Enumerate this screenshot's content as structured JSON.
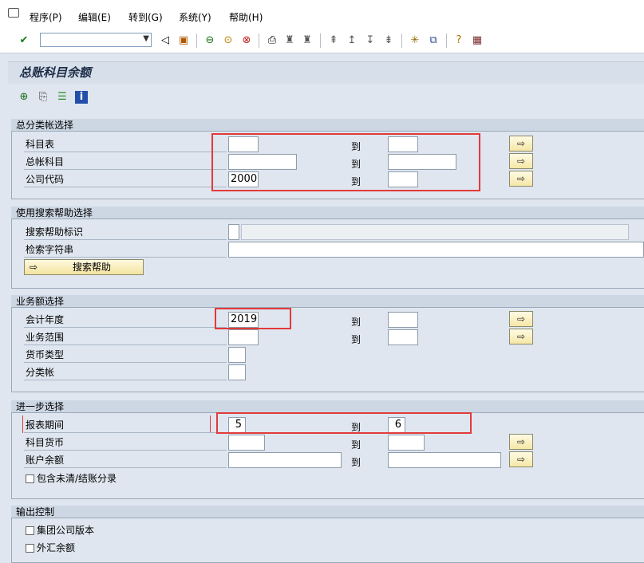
{
  "menu": {
    "items": [
      "程序(P)",
      "编辑(E)",
      "转到(G)",
      "系统(Y)",
      "帮助(H)"
    ]
  },
  "toolbar": {
    "command_value": "",
    "icons": [
      "check-icon",
      "back-icon",
      "save-icon",
      "green-arrow-icon",
      "exit-icon",
      "cancel-icon",
      "print-icon",
      "find-icon",
      "find-next-icon",
      "first-page-icon",
      "prev-page-icon",
      "next-page-icon",
      "last-page-icon",
      "new-session-icon",
      "shortcut-icon",
      "help-icon",
      "layout-icon"
    ]
  },
  "title": "总账科目余额",
  "app_toolbar_icons": [
    "execute-icon",
    "variant-icon",
    "selection-options-icon",
    "info-icon"
  ],
  "groups": {
    "gl_selection": {
      "title": "总分类帐选择",
      "rows": [
        {
          "label": "科目表",
          "from": "",
          "to_label": "到",
          "to": ""
        },
        {
          "label": "总帐科目",
          "from": "",
          "to_label": "到",
          "to": ""
        },
        {
          "label": "公司代码",
          "from": "2000",
          "to_label": "到",
          "to": ""
        }
      ]
    },
    "search_help": {
      "title": "使用搜索帮助选择",
      "id_label": "搜索帮助标识",
      "string_label": "检索字符串",
      "button_label": "搜索帮助"
    },
    "transactions": {
      "title": "业务额选择",
      "rows": [
        {
          "label": "会计年度",
          "from": "2019",
          "to_label": "到",
          "to": ""
        },
        {
          "label": "业务范围",
          "from": "",
          "to_label": "到",
          "to": ""
        },
        {
          "label": "货币类型",
          "from": ""
        },
        {
          "label": "分类帐",
          "from": ""
        }
      ]
    },
    "further": {
      "title": "进一步选择",
      "rows": [
        {
          "label": "报表期间",
          "from": "5",
          "to_label": "到",
          "to": "6"
        },
        {
          "label": "科目货币",
          "from": "",
          "to_label": "到",
          "to": ""
        },
        {
          "label": "账户余额",
          "from": "",
          "to_label": "到",
          "to": ""
        }
      ],
      "checkbox_label": "包含未清/结账分录"
    },
    "output": {
      "title": "输出控制",
      "checkboxes": [
        "集团公司版本",
        "外汇余额"
      ]
    }
  },
  "colors": {
    "highlight": "#e23a3a",
    "background": "#dfe6ef"
  }
}
